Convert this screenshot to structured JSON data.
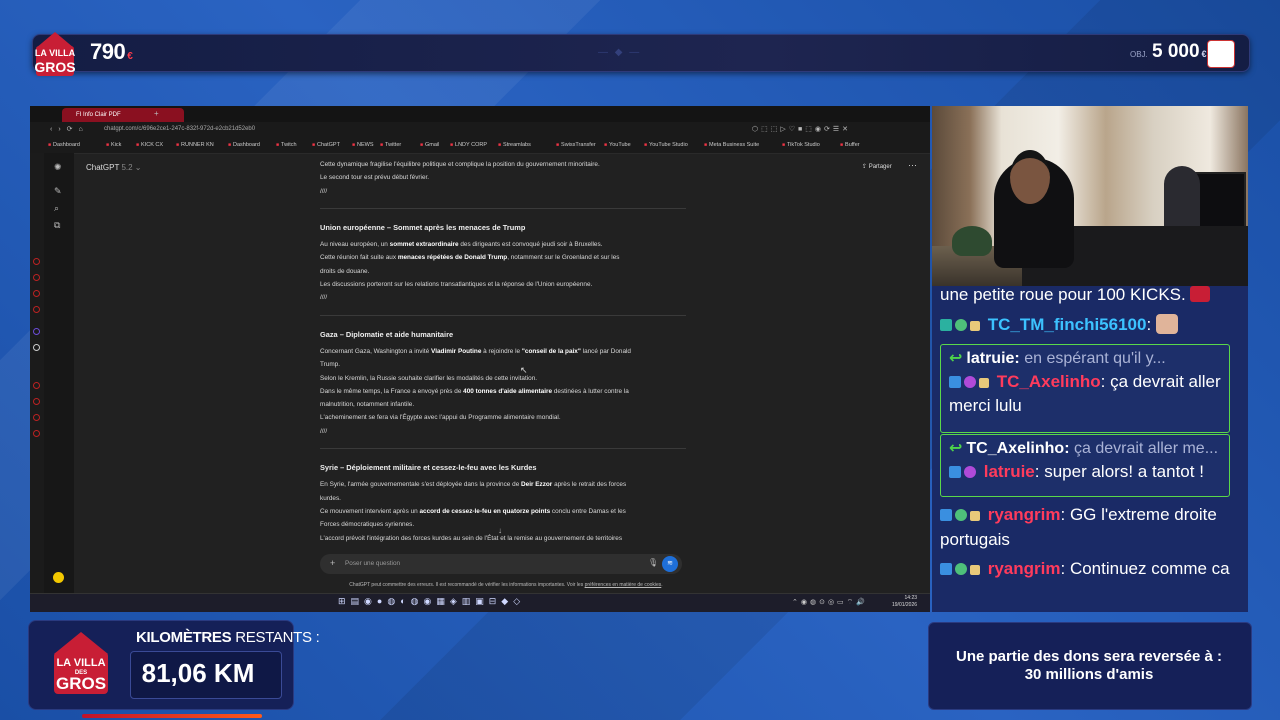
{
  "overlay": {
    "brand": "LA VILLA DES GROS",
    "brand_line1": "LA VILLA",
    "brand_line2": "DES",
    "brand_line3": "GROS",
    "current_count": "790",
    "current_unit": "€",
    "goal_prefix": "OBJ.",
    "goal": "5 000",
    "goal_unit": "€",
    "km_label_bold": "KILOMÈTRES",
    "km_label_rest": " RESTANTS :",
    "km_value": "81,06 KM",
    "donation_line1": "Une partie des dons sera reversée à :",
    "donation_line2": "30 millions d'amis",
    "colors": {
      "accent_red": "#c81e35",
      "panel_navy": "#152058",
      "chat_green_border": "#5ad84a"
    }
  },
  "browser": {
    "tab_title": "FI Info Clair PDF",
    "url": "chatgpt.com/c/696e2ce1-247c-832f-972d-e2cb21d52eb0",
    "bookmarks": [
      "Dashboard",
      "Kick",
      "KICK CX",
      "RUNNER KN",
      "Dashboard",
      "Twitch",
      "ChatGPT",
      "NEWS",
      "Twitter",
      "Gmail",
      "LNDY CORP",
      "Streamlabs",
      "SwissTransfer",
      "YouTube",
      "YouTube Studio",
      "Meta Business Suite",
      "TikTok Studio",
      "Buffer"
    ]
  },
  "chatgpt": {
    "model_label": "ChatGPT",
    "model_version": "5.2",
    "share_label": "Partager",
    "input_placeholder": "Poser une question",
    "disclaimer_text": "ChatGPT peut commettre des erreurs. Il est recommandé de vérifier les informations importantes. Voir les ",
    "disclaimer_link": "préférences en matière de cookies",
    "top_lines": [
      "Cette dynamique fragilise l'équilibre politique et complique la position du gouvernement minoritaire.",
      "Le second tour est prévu début février.",
      "////"
    ],
    "section_eu": {
      "title": "Union européenne – Sommet après les menaces de Trump",
      "l1a": "Au niveau européen, un ",
      "l1b": "sommet extraordinaire",
      "l1c": " des dirigeants est convoqué jeudi soir à Bruxelles.",
      "l2a": "Cette réunion fait suite aux ",
      "l2b": "menaces répétées de Donald Trump",
      "l2c": ", notamment sur le Groenland et sur les",
      "l3": "droits de douane.",
      "l4": "Les discussions porteront sur les relations transatlantiques et la réponse de l'Union européenne.",
      "sep": "////"
    },
    "section_gaza": {
      "title": "Gaza – Diplomatie et aide humanitaire",
      "l1a": "Concernant Gaza, Washington a invité ",
      "l1b": "Vladimir Poutine",
      "l1c": " à rejoindre le ",
      "l1d": "\"conseil de la paix\"",
      "l1e": " lancé par Donald",
      "l2": "Trump.",
      "l3": "Selon le Kremlin, la Russie souhaite clarifier les modalités de cette invitation.",
      "l4a": "Dans le même temps, la France a envoyé près de ",
      "l4b": "400 tonnes d'aide alimentaire",
      "l4c": " destinées à lutter contre la",
      "l5": "malnutrition, notamment infantile.",
      "l6": "L'acheminement se fera via l'Égypte avec l'appui du Programme alimentaire mondial.",
      "sep": "////"
    },
    "section_syria": {
      "title": "Syrie – Déploiement militaire et cessez-le-feu avec les Kurdes",
      "l1a": "En Syrie, l'armée gouvernementale s'est déployée dans la province de ",
      "l1b": "Deir Ezzor",
      "l1c": " après le retrait des forces",
      "l2": "kurdes.",
      "l3a": "Ce mouvement intervient après un ",
      "l3b": "accord de cessez-le-feu en quatorze points",
      "l3c": " conclu entre Damas et les",
      "l4": "Forces démocratiques syriennes.",
      "l5": "L'accord prévoit l'intégration des forces kurdes au sein de l'État et la remise au gouvernement de territoires"
    }
  },
  "taskbar": {
    "time": "14:23",
    "date": "19/01/2026"
  },
  "chat": {
    "line0": "une petite roue pour 100 KICKS.",
    "msg1_user": "TC_TM_finchi56100",
    "reply1_user": "latruie:",
    "reply1_preview": "en espérant qu'il y...",
    "msg2_user": "TC_Axelinho",
    "msg2_text": "ça devrait aller merci lulu",
    "reply2_user": "TC_Axelinho:",
    "reply2_preview": "ça devrait aller me...",
    "msg3_user": "latruie",
    "msg3_text": "super alors! a tantot !",
    "msg4_user": "ryangrim",
    "msg4_text": "GG l'extreme droite portugais",
    "msg5_user": "ryangrim",
    "msg5_text": "Continuez comme ca"
  }
}
